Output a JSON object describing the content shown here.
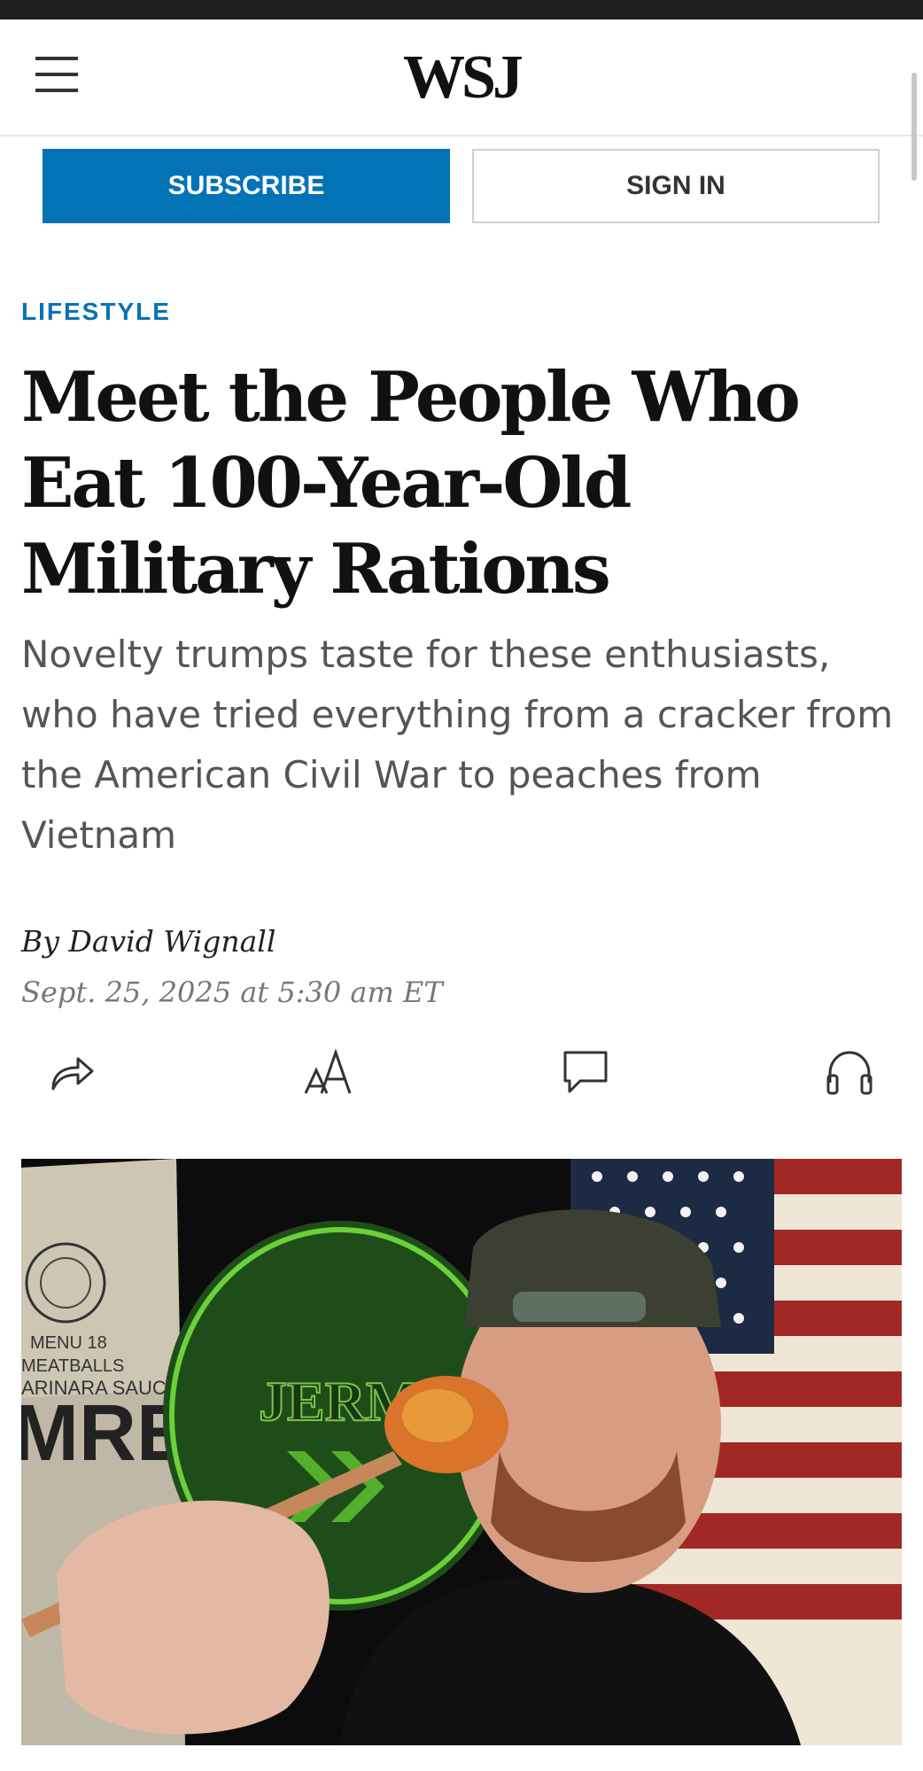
{
  "header": {
    "logo": "WSJ",
    "menu_icon": "hamburger-menu-icon"
  },
  "actions": {
    "subscribe_label": "SUBSCRIBE",
    "signin_label": "SIGN IN"
  },
  "article": {
    "section": "LIFESTYLE",
    "headline": "Meet the People Who Eat 100-Year-Old Military Rations",
    "dek": "Novelty trumps taste for these enthusiasts, who have tried everything from a cracker from the American Civil War to peaches from Vietnam",
    "byline": "By David Wignall",
    "date": "Sept. 25, 2025 at 5:30 am ET"
  },
  "toolbar": [
    {
      "icon": "share-icon"
    },
    {
      "icon": "text-size-icon"
    },
    {
      "icon": "comment-icon"
    },
    {
      "icon": "headphones-icon"
    }
  ],
  "photo": {
    "package_text_1": "MENU 18",
    "package_text_2": "MEATBALLS",
    "package_text_3": "ARINARA SAUCE",
    "package_text_4": "MRE",
    "sign_text": "JERMS"
  },
  "colors": {
    "accent": "#0274b6",
    "section": "#0a72b3",
    "headline": "#111111",
    "dek": "#555555"
  }
}
